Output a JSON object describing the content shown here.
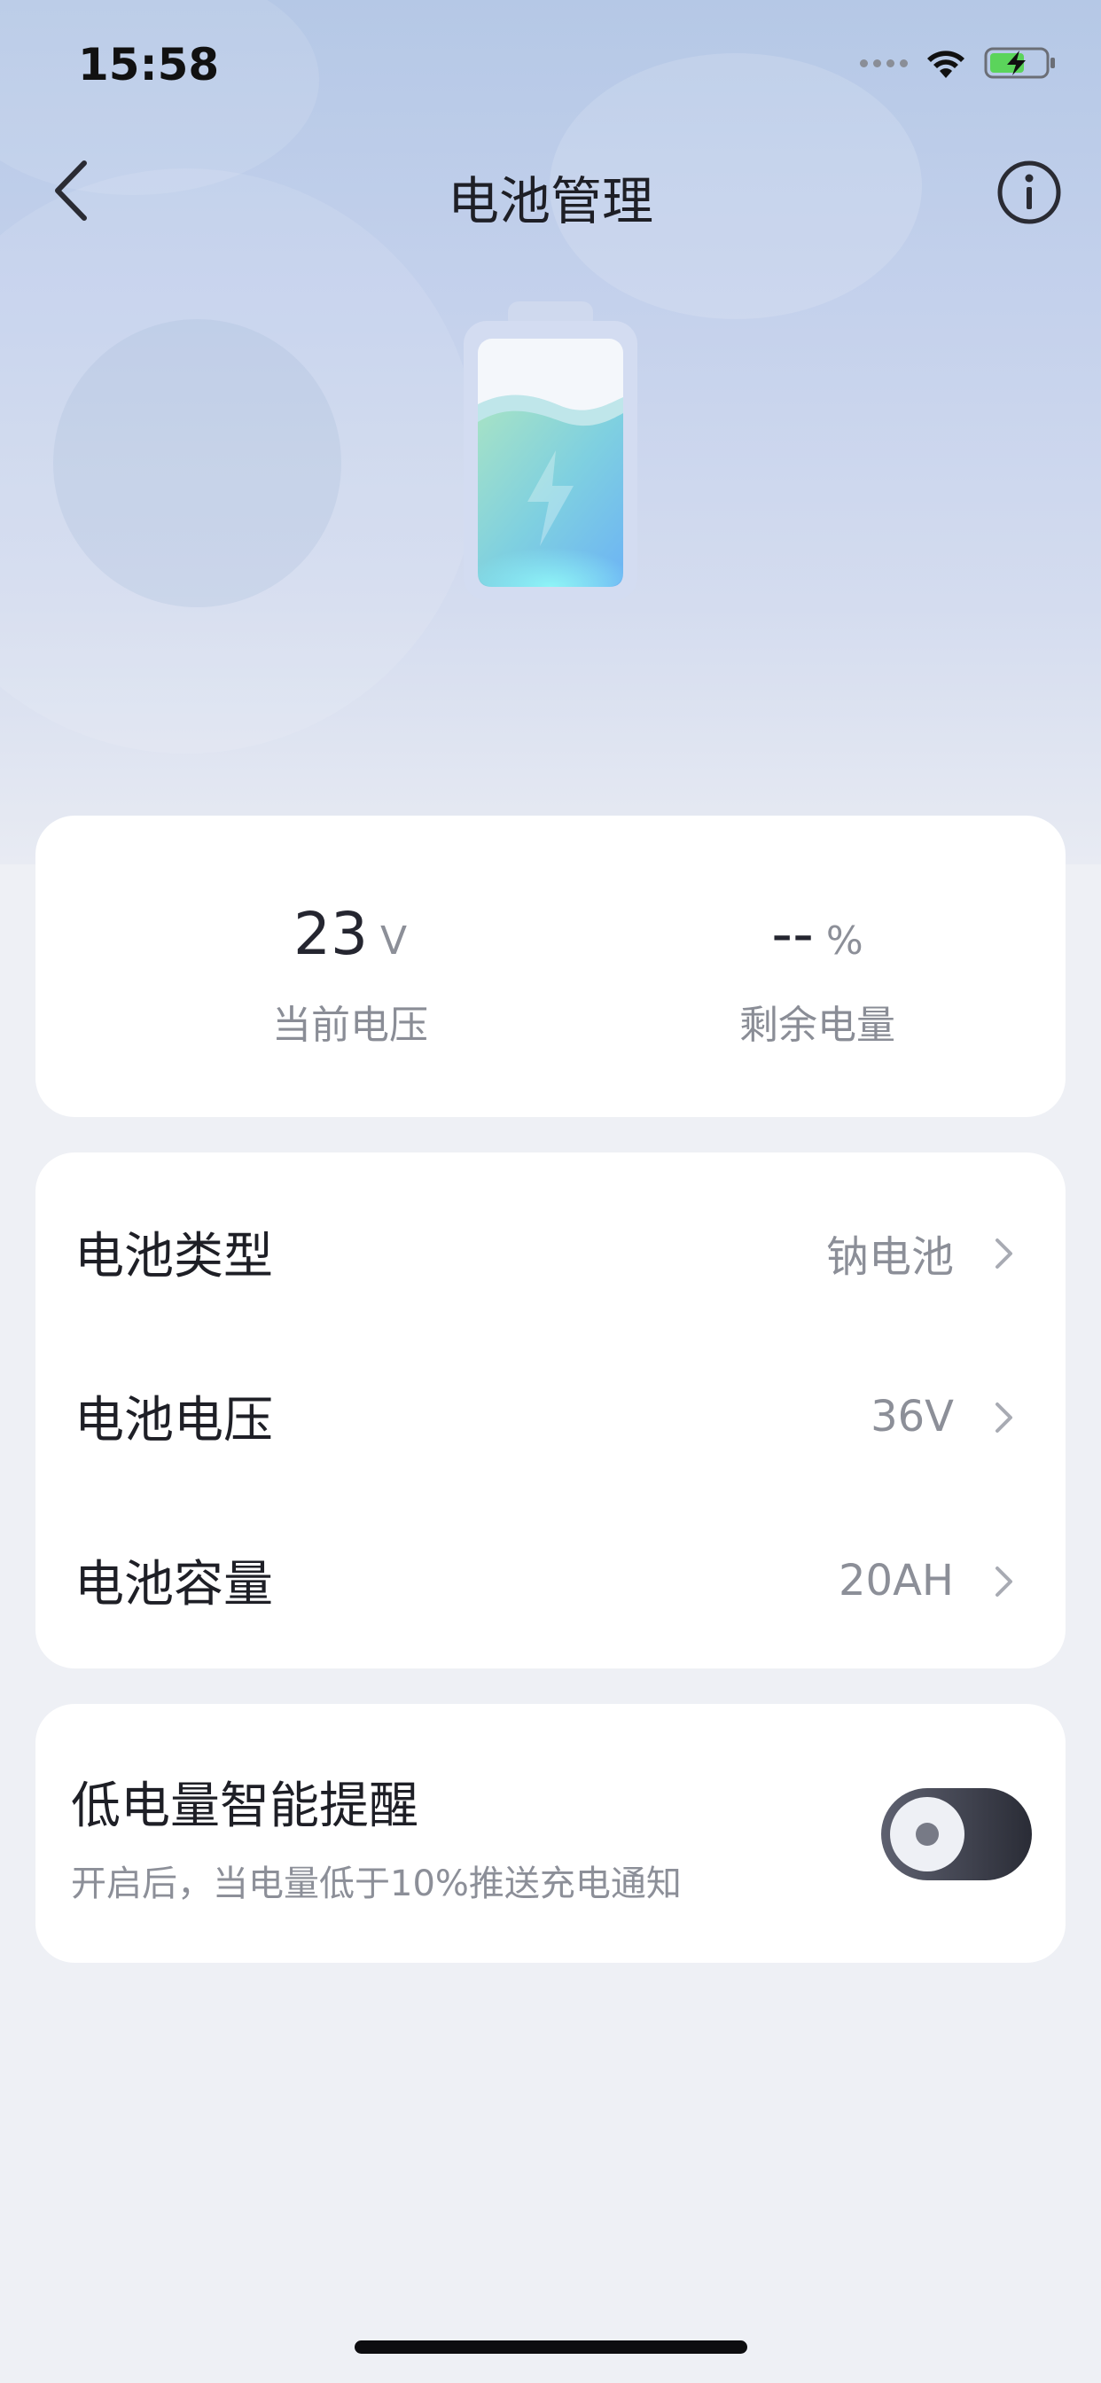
{
  "status_bar": {
    "time": "15:58"
  },
  "nav": {
    "title": "电池管理"
  },
  "stats": {
    "voltage": {
      "value": "23",
      "unit": "V",
      "label": "当前电压"
    },
    "remaining": {
      "value": "--",
      "unit": "%",
      "label": "剩余电量"
    }
  },
  "battery_info": {
    "rows": [
      {
        "label": "电池类型",
        "value": "钠电池"
      },
      {
        "label": "电池电压",
        "value": "36V"
      },
      {
        "label": "电池容量",
        "value": "20AH"
      }
    ]
  },
  "low_battery_alert": {
    "title": "低电量智能提醒",
    "subtitle": "开启后，当电量低于10%推送充电通知"
  },
  "icons": {
    "back": "chevron-left-icon",
    "info": "info-circle-icon",
    "wifi": "wifi-icon",
    "battery_status": "battery-charging-icon",
    "row_chevron": "chevron-right-icon"
  },
  "colors": {
    "hero_bg": "#b5c8e6",
    "page_bg": "#eef0f5",
    "text_primary": "#1e1f26",
    "text_secondary": "#8c8f98",
    "toggle_dark": "#2a2c36",
    "battery_green": "#5bd45b"
  }
}
